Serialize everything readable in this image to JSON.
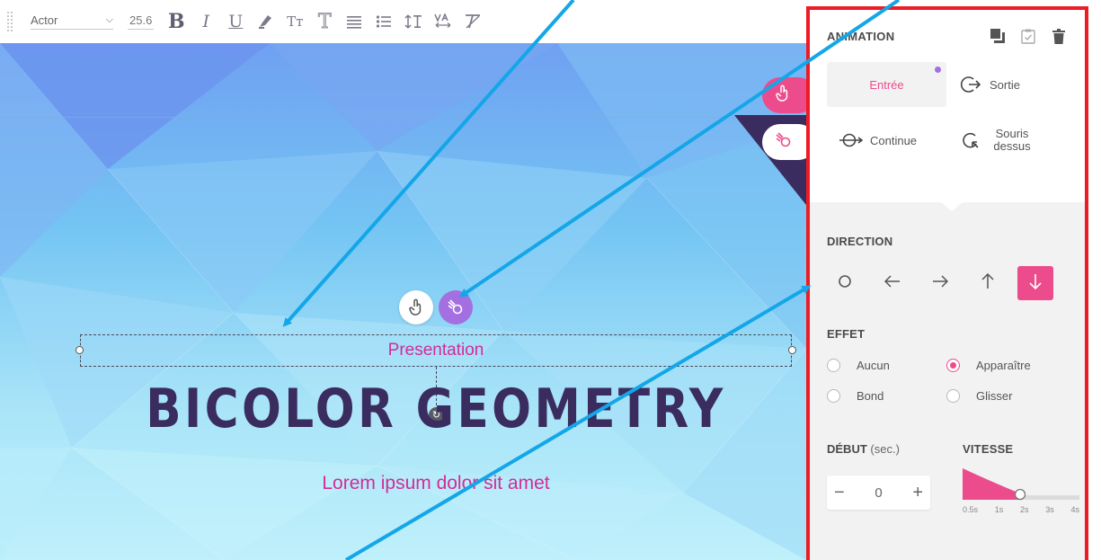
{
  "toolbar": {
    "font_name": "Actor",
    "font_size": "25.6",
    "bold_glyph": "B",
    "italic_glyph": "I",
    "underline_glyph": "U",
    "case_glyph": "Tт",
    "outline_glyph": "T"
  },
  "canvas": {
    "selected_text": "Presentation",
    "headline": "BICOLOR GEOMETRY",
    "subtitle": "Lorem ipsum dolor sit amet"
  },
  "panel": {
    "title": "ANIMATION",
    "tabs": [
      {
        "label": "Entrée",
        "active": true,
        "icon": "enter-dot-icon"
      },
      {
        "label": "Sortie",
        "active": false,
        "icon": "exit-arrow-icon"
      },
      {
        "label": "Continue",
        "active": false,
        "icon": "continue-icon"
      },
      {
        "label": "Souris dessus",
        "active": false,
        "icon": "hover-icon"
      }
    ],
    "direction": {
      "label": "DIRECTION",
      "options": [
        "none-circle-icon",
        "arrow-left-icon",
        "arrow-right-icon",
        "arrow-up-icon",
        "arrow-down-icon"
      ],
      "selected": "arrow-down-icon"
    },
    "effect": {
      "label": "EFFET",
      "options": [
        "Aucun",
        "Apparaître",
        "Bond",
        "Glisser"
      ],
      "selected": "Apparaître"
    },
    "start": {
      "label": "DÉBUT",
      "unit": "(sec.)",
      "value": "0",
      "minus": "−",
      "plus": "+"
    },
    "speed": {
      "label": "VITESSE",
      "ticks": [
        "0.5s",
        "1s",
        "2s",
        "3s",
        "4s"
      ],
      "selected": "2s"
    }
  },
  "colors": {
    "accent_pink": "#ec4c8c",
    "accent_purple": "#a46fe0",
    "panel_border": "#ee1b24",
    "annotation_arrow": "#13a6e8",
    "headline": "#3a2c5e",
    "magenta_text": "#d22c97"
  }
}
